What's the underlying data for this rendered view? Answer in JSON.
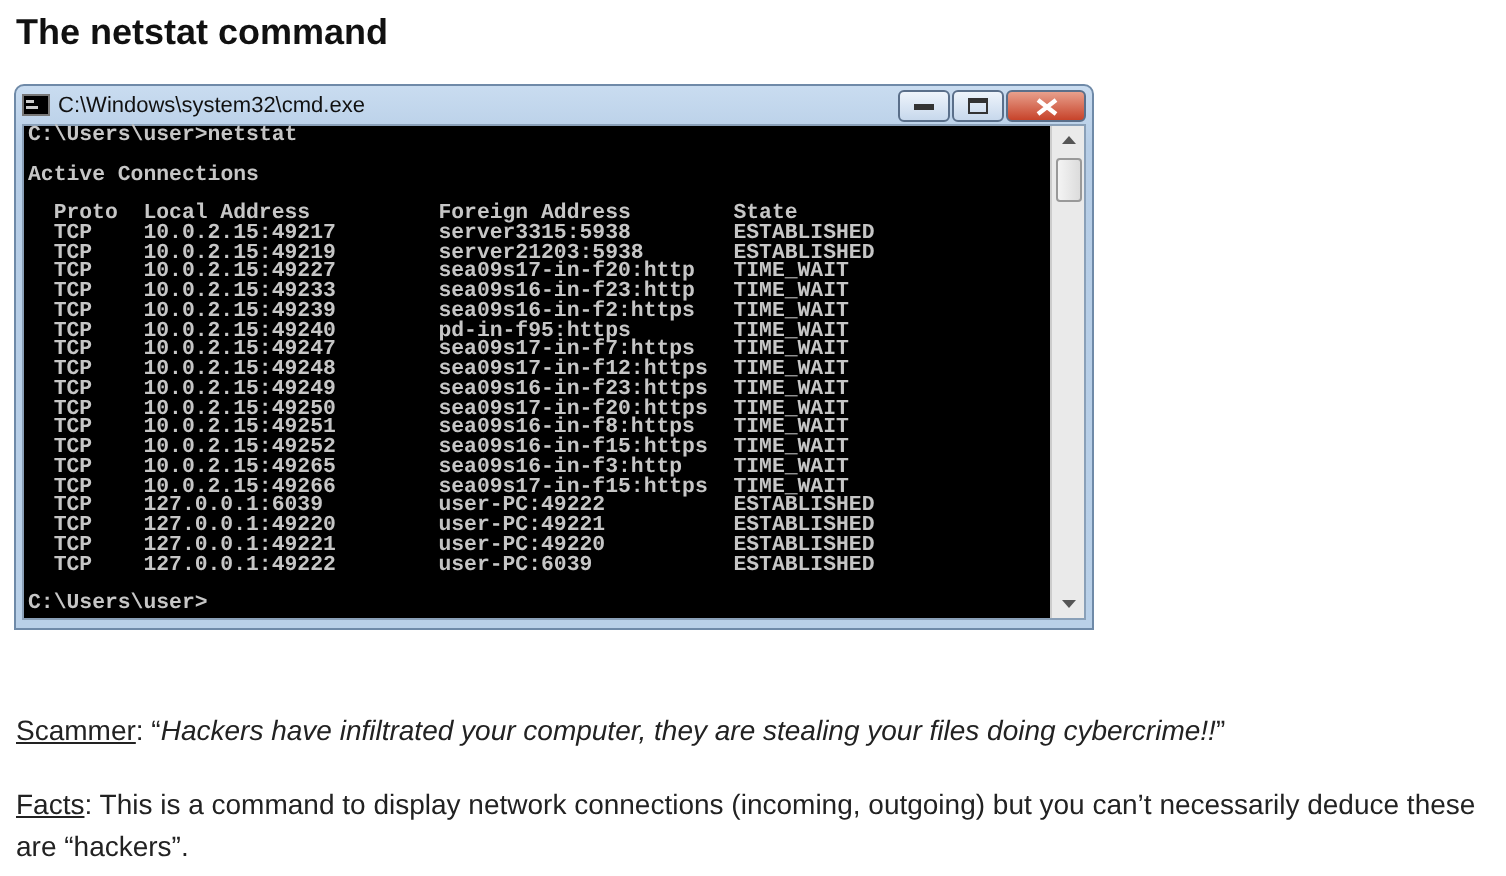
{
  "heading": "The netstat command",
  "window": {
    "title": "C:\\Windows\\system32\\cmd.exe"
  },
  "console": {
    "command_line": "C:\\Users\\user>netstat",
    "section_title": "Active Connections",
    "columns": [
      "Proto",
      "Local Address",
      "Foreign Address",
      "State"
    ],
    "rows": [
      [
        "TCP",
        "10.0.2.15:49217",
        "server3315:5938",
        "ESTABLISHED"
      ],
      [
        "TCP",
        "10.0.2.15:49219",
        "server21203:5938",
        "ESTABLISHED"
      ],
      [
        "TCP",
        "10.0.2.15:49227",
        "sea09s17-in-f20:http",
        "TIME_WAIT"
      ],
      [
        "TCP",
        "10.0.2.15:49233",
        "sea09s16-in-f23:http",
        "TIME_WAIT"
      ],
      [
        "TCP",
        "10.0.2.15:49239",
        "sea09s16-in-f2:https",
        "TIME_WAIT"
      ],
      [
        "TCP",
        "10.0.2.15:49240",
        "pd-in-f95:https",
        "TIME_WAIT"
      ],
      [
        "TCP",
        "10.0.2.15:49247",
        "sea09s17-in-f7:https",
        "TIME_WAIT"
      ],
      [
        "TCP",
        "10.0.2.15:49248",
        "sea09s17-in-f12:https",
        "TIME_WAIT"
      ],
      [
        "TCP",
        "10.0.2.15:49249",
        "sea09s16-in-f23:https",
        "TIME_WAIT"
      ],
      [
        "TCP",
        "10.0.2.15:49250",
        "sea09s17-in-f20:https",
        "TIME_WAIT"
      ],
      [
        "TCP",
        "10.0.2.15:49251",
        "sea09s16-in-f8:https",
        "TIME_WAIT"
      ],
      [
        "TCP",
        "10.0.2.15:49252",
        "sea09s16-in-f15:https",
        "TIME_WAIT"
      ],
      [
        "TCP",
        "10.0.2.15:49265",
        "sea09s16-in-f3:http",
        "TIME_WAIT"
      ],
      [
        "TCP",
        "10.0.2.15:49266",
        "sea09s17-in-f15:https",
        "TIME_WAIT"
      ],
      [
        "TCP",
        "127.0.0.1:6039",
        "user-PC:49222",
        "ESTABLISHED"
      ],
      [
        "TCP",
        "127.0.0.1:49220",
        "user-PC:49221",
        "ESTABLISHED"
      ],
      [
        "TCP",
        "127.0.0.1:49221",
        "user-PC:49220",
        "ESTABLISHED"
      ],
      [
        "TCP",
        "127.0.0.1:49222",
        "user-PC:6039",
        "ESTABLISHED"
      ]
    ],
    "prompt": "C:\\Users\\user>"
  },
  "paragraphs": [
    {
      "label": "Scammer",
      "text": ": “*Hackers have infiltrated your computer, they are stealing your files doing cybercrime!!*”"
    },
    {
      "label": "Facts",
      "text": ": This is a command to display network connections (incoming, outgoing) but you can’t necessarily deduce these are “hackers”."
    }
  ]
}
